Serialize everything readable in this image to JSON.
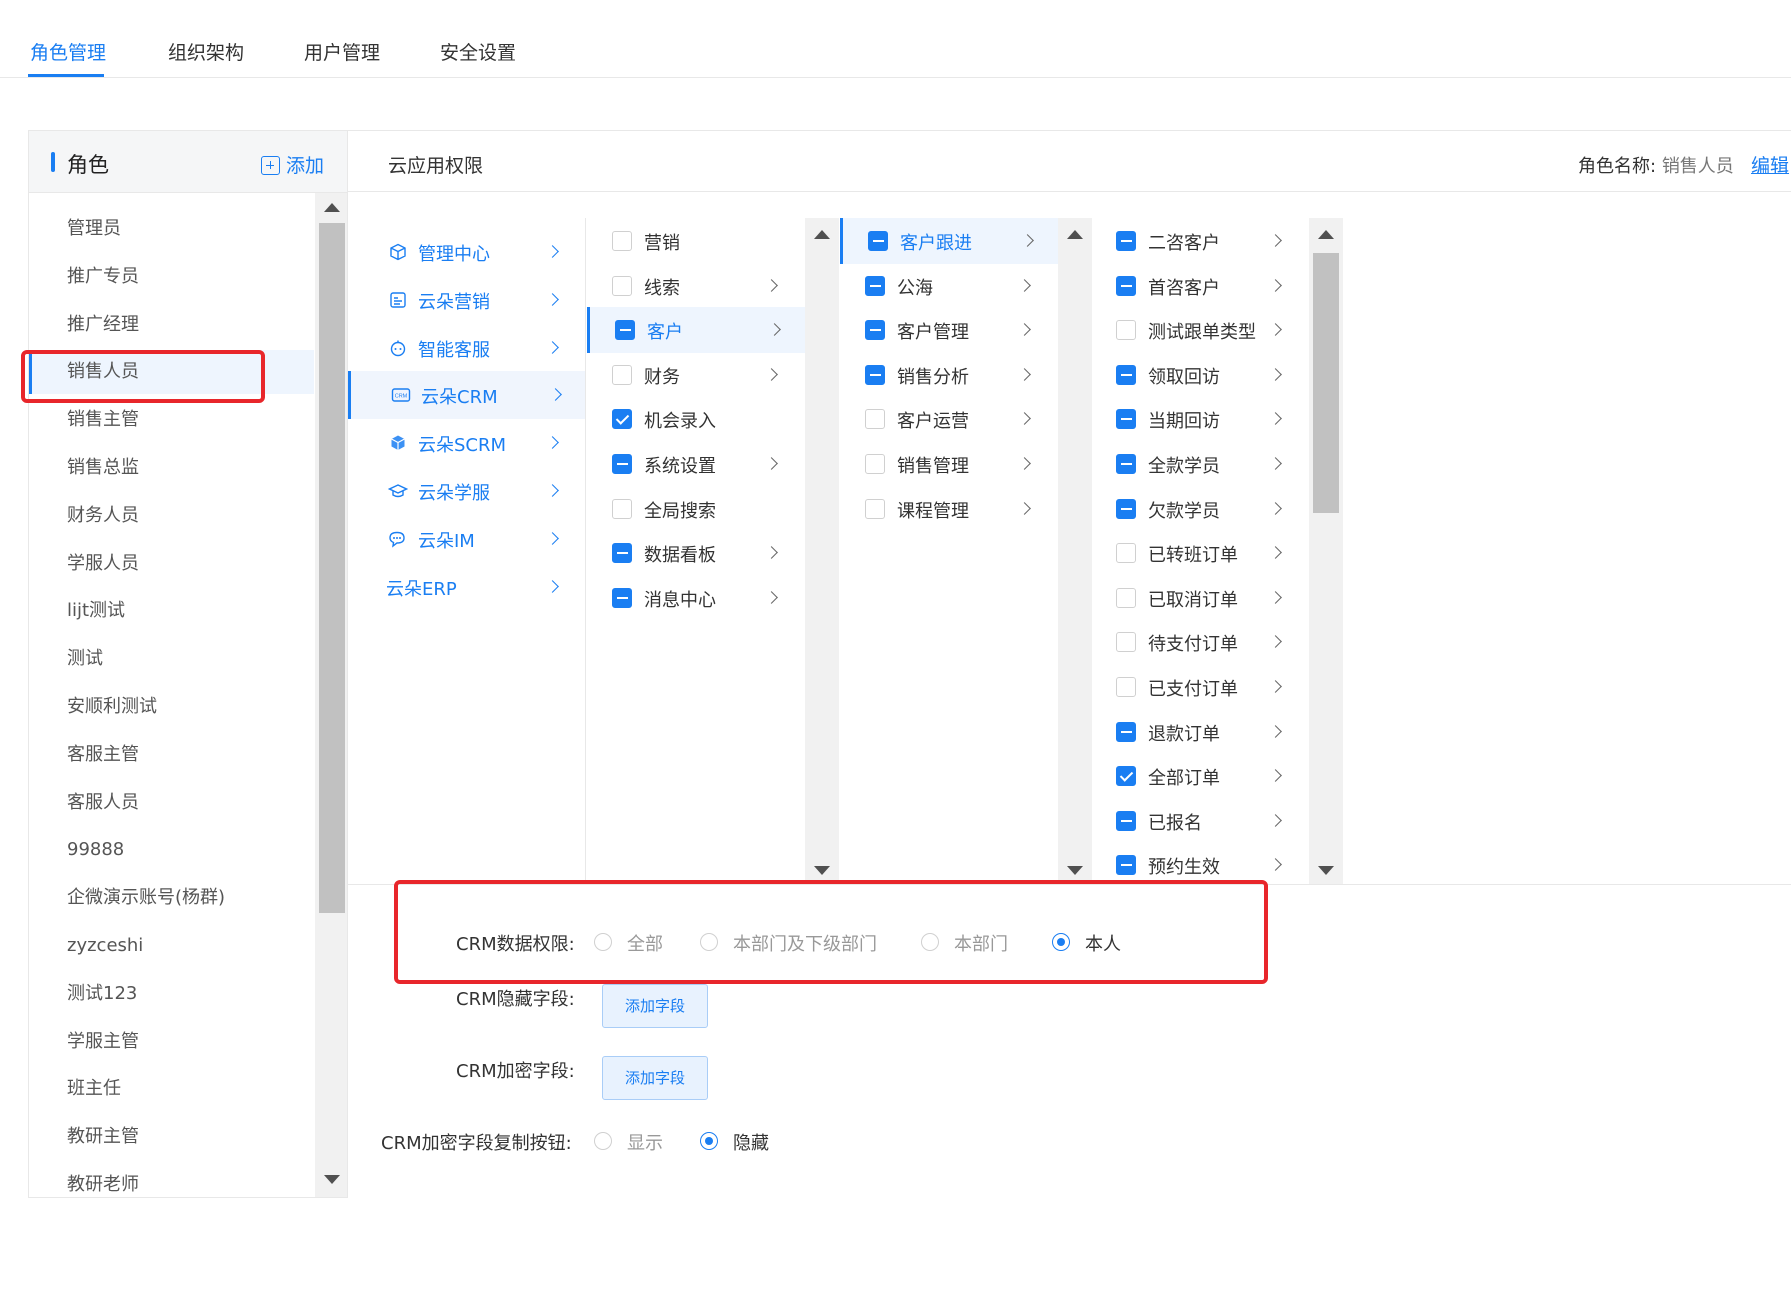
{
  "tabs": [
    "角色管理",
    "组织架构",
    "用户管理",
    "安全设置"
  ],
  "role_panel": {
    "title": "角色",
    "add_label": "添加",
    "roles": [
      "管理员",
      "推广专员",
      "推广经理",
      "销售人员",
      "销售主管",
      "销售总监",
      "财务人员",
      "学服人员",
      "lijt测试",
      "测试",
      "安顺利测试",
      "客服主管",
      "客服人员",
      "99888",
      "企微演示账号(杨群)",
      "zyzceshi",
      "测试123",
      "学服主管",
      "班主任",
      "教研主管",
      "教研老师"
    ],
    "selected_role": "销售人员"
  },
  "main": {
    "title": "云应用权限",
    "role_name_label": "角色名称:",
    "role_name_value": "销售人员",
    "edit_label": "编辑"
  },
  "apps": [
    {
      "label": "管理中心",
      "icon": "cube-icon"
    },
    {
      "label": "云朵营销",
      "icon": "marketing-icon"
    },
    {
      "label": "智能客服",
      "icon": "robot-icon"
    },
    {
      "label": "云朵CRM",
      "icon": "crm-icon",
      "active": true
    },
    {
      "label": "云朵SCRM",
      "icon": "scrm-icon"
    },
    {
      "label": "云朵学服",
      "icon": "graduation-cap-icon"
    },
    {
      "label": "云朵IM",
      "icon": "chat-icon"
    },
    {
      "label": "云朵ERP",
      "icon": ""
    }
  ],
  "col2": [
    {
      "label": "营销",
      "state": "none",
      "arrow": false
    },
    {
      "label": "线索",
      "state": "none",
      "arrow": true
    },
    {
      "label": "客户",
      "state": "indeterminate",
      "arrow": true,
      "active": true
    },
    {
      "label": "财务",
      "state": "none",
      "arrow": true
    },
    {
      "label": "机会录入",
      "state": "checked",
      "arrow": false
    },
    {
      "label": "系统设置",
      "state": "indeterminate",
      "arrow": true
    },
    {
      "label": "全局搜索",
      "state": "none",
      "arrow": false
    },
    {
      "label": "数据看板",
      "state": "indeterminate",
      "arrow": true
    },
    {
      "label": "消息中心",
      "state": "indeterminate",
      "arrow": true
    }
  ],
  "col3": [
    {
      "label": "客户跟进",
      "state": "indeterminate",
      "arrow": true,
      "active": true
    },
    {
      "label": "公海",
      "state": "indeterminate",
      "arrow": true
    },
    {
      "label": "客户管理",
      "state": "indeterminate",
      "arrow": true
    },
    {
      "label": "销售分析",
      "state": "indeterminate",
      "arrow": true
    },
    {
      "label": "客户运营",
      "state": "none",
      "arrow": true
    },
    {
      "label": "销售管理",
      "state": "none",
      "arrow": true
    },
    {
      "label": "课程管理",
      "state": "none",
      "arrow": true
    }
  ],
  "col4": [
    {
      "label": "二咨客户",
      "state": "indeterminate",
      "arrow": true
    },
    {
      "label": "首咨客户",
      "state": "indeterminate",
      "arrow": true
    },
    {
      "label": "测试跟单类型",
      "state": "none",
      "arrow": true
    },
    {
      "label": "领取回访",
      "state": "indeterminate",
      "arrow": true
    },
    {
      "label": "当期回访",
      "state": "indeterminate",
      "arrow": true
    },
    {
      "label": "全款学员",
      "state": "indeterminate",
      "arrow": true
    },
    {
      "label": "欠款学员",
      "state": "indeterminate",
      "arrow": true
    },
    {
      "label": "已转班订单",
      "state": "none",
      "arrow": true
    },
    {
      "label": "已取消订单",
      "state": "none",
      "arrow": true
    },
    {
      "label": "待支付订单",
      "state": "none",
      "arrow": true
    },
    {
      "label": "已支付订单",
      "state": "none",
      "arrow": true
    },
    {
      "label": "退款订单",
      "state": "indeterminate",
      "arrow": true
    },
    {
      "label": "全部订单",
      "state": "checked",
      "arrow": true
    },
    {
      "label": "已报名",
      "state": "indeterminate",
      "arrow": true
    },
    {
      "label": "预约生效",
      "state": "indeterminate",
      "arrow": true
    }
  ],
  "settings": {
    "data_perm_label": "CRM数据权限:",
    "data_perm_options": [
      "全部",
      "本部门及下级部门",
      "本部门",
      "本人"
    ],
    "data_perm_selected": "本人",
    "hidden_fields_label": "CRM隐藏字段:",
    "encrypted_fields_label": "CRM加密字段:",
    "add_field_label": "添加字段",
    "copy_btn_label": "CRM加密字段复制按钮:",
    "copy_btn_options": [
      "显示",
      "隐藏"
    ],
    "copy_btn_selected": "隐藏"
  },
  "colors": {
    "accent": "#1a7ef2",
    "highlight": "#e8262b"
  }
}
